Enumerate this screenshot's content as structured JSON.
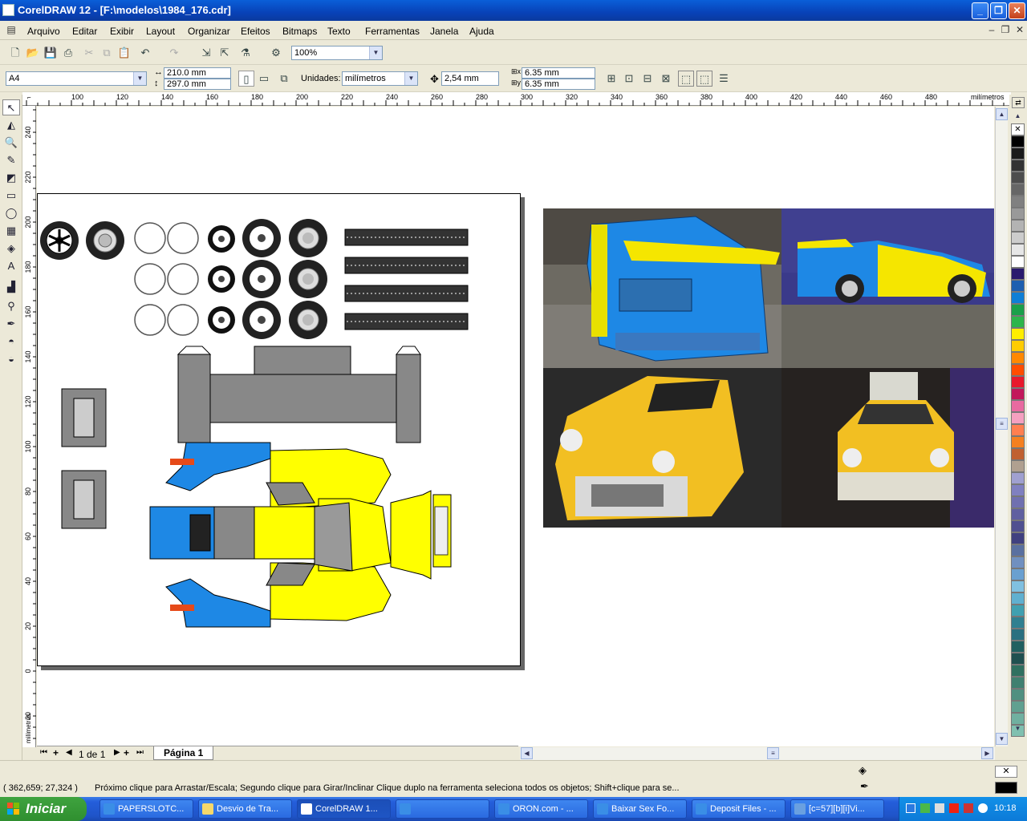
{
  "window": {
    "title": "CorelDRAW 12 - [F:\\modelos\\1984_176.cdr]"
  },
  "menu": [
    "Arquivo",
    "Editar",
    "Exibir",
    "Layout",
    "Organizar",
    "Efeitos",
    "Bitmaps",
    "Texto",
    "Ferramentas",
    "Janela",
    "Ajuda"
  ],
  "toolbar": {
    "zoom": "100%"
  },
  "propertybar": {
    "paper": "A4",
    "width": "210.0 mm",
    "height": "297.0 mm",
    "units_label": "Unidades:",
    "units": "milímetros",
    "nudge": "2,54 mm",
    "dup_x": "6.35 mm",
    "dup_y": "6.35 mm"
  },
  "ruler": {
    "h_unit": "milímetros",
    "v_unit": "milímetros",
    "h_ticks": [
      "100",
      "120",
      "140",
      "160",
      "180",
      "200",
      "220",
      "240",
      "260",
      "280",
      "300",
      "320",
      "340",
      "360",
      "380",
      "400",
      "420",
      "440",
      "460",
      "480"
    ],
    "v_ticks": [
      "240",
      "220",
      "200",
      "180",
      "160",
      "140",
      "120",
      "100",
      "80",
      "60",
      "40",
      "20",
      "0",
      "20"
    ]
  },
  "pagetabs": {
    "counter": "1 de 1",
    "tab": "Página 1"
  },
  "status": {
    "coords": "( 362,659; 27,324 )",
    "hint": "Próximo clique para Arrastar/Escala; Segundo clique para Girar/Inclinar Clique duplo na ferramenta seleciona todos os objetos; Shift+clique para se..."
  },
  "taskbar": {
    "start": "Iniciar",
    "tasks": [
      "PAPERSLOTC...",
      "Desvio de Tra...",
      "CorelDRAW 1...",
      "",
      "ORON.com - ...",
      "Baixar Sex Fo...",
      "Deposit Files - ...",
      "[c=57][b][i]Vi..."
    ],
    "clock": "10:18"
  },
  "palette": [
    "#ffffff",
    "#000000",
    "#1a1a1a",
    "#333333",
    "#4d4d4d",
    "#666666",
    "#808080",
    "#999999",
    "#b3b3b3",
    "#cccccc",
    "#e6e6e6",
    "#ffffff",
    "#2a1a6e",
    "#1e5fb0",
    "#0f7fd6",
    "#1aa04a",
    "#2db54b",
    "#ffee00",
    "#ffcc00",
    "#ff8800",
    "#ff4d00",
    "#e8192c",
    "#c2185b",
    "#e86aa0",
    "#f5a0c0",
    "#ff7f50",
    "#f58020",
    "#c06030",
    "#b0a090",
    "#a0a0d0",
    "#8080c0",
    "#7070b0",
    "#6060a0",
    "#505090",
    "#404080",
    "#5a70a0",
    "#7090c0",
    "#6aa0d0",
    "#80c0e0",
    "#60b0d0",
    "#40a0b0",
    "#308090",
    "#2a7080",
    "#206060",
    "#205050",
    "#307060",
    "#408070",
    "#509080",
    "#60a090",
    "#70b0a0",
    "#80c0b0"
  ],
  "colors": {
    "accent": "#0a5fd8",
    "car_yellow": "#ffff00",
    "car_blue": "#1e88e5",
    "car_gray": "#808080"
  }
}
